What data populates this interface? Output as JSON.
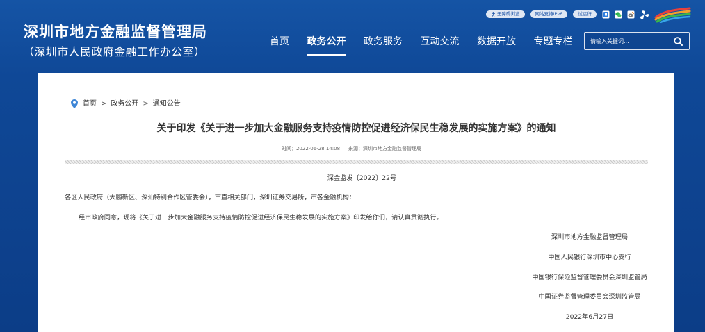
{
  "header": {
    "title": "深圳市地方金融监督管理局",
    "subtitle": "（深圳市人民政府金融工作办公室）",
    "top_links": [
      {
        "label": "无障碍浏览",
        "icon": "accessibility-icon"
      },
      {
        "label": "网站支持IPv6"
      },
      {
        "label": "试运行"
      }
    ],
    "top_icons": [
      "mobile-icon",
      "wechat-icon",
      "weibo-icon",
      "pinwheel-icon"
    ],
    "logo_icon": "i-shenzhen-logo",
    "nav": [
      {
        "label": "首页",
        "active": false
      },
      {
        "label": "政务公开",
        "active": true
      },
      {
        "label": "政务服务",
        "active": false
      },
      {
        "label": "互动交流",
        "active": false
      },
      {
        "label": "数据开放",
        "active": false
      },
      {
        "label": "专题专栏",
        "active": false
      }
    ],
    "search": {
      "placeholder": "请输入关键词...",
      "icon": "search-icon"
    }
  },
  "breadcrumb": {
    "icon": "location-pin-icon",
    "separator": ">",
    "items": [
      {
        "label": "首页"
      },
      {
        "label": "政务公开"
      },
      {
        "label": "通知公告"
      }
    ]
  },
  "article": {
    "title": "关于印发《关于进一步加大金融服务支持疫情防控促进经济保民生稳发展的实施方案》的通知",
    "time": "时间：2022-06-28 14:08",
    "source": "来源：深圳市地方金融监督管理局",
    "doc_number": "深金监发〔2022〕22号",
    "salutation": "各区人民政府（大鹏新区、深汕特别合作区管委会），市直相关部门，深圳证券交易所，市各金融机构：",
    "body": "经市政府同意，现将《关于进一步加大金融服务支持疫情防控促进经济保民生稳发展的实施方案》印发给你们，请认真贯彻执行。",
    "signatories": [
      "深圳市地方金融监督管理局",
      "中国人民银行深圳市中心支行",
      "中国银行保险监督管理委员会深圳监管局",
      "中国证券监督管理委员会深圳监管局"
    ],
    "date": "2022年6月27日"
  },
  "colors": {
    "brand_blue": "#0f4897",
    "pill_bg": "#dfe7f3",
    "pill_text": "#1f56a8",
    "pin_blue": "#3e86d6",
    "text": "#333333"
  }
}
